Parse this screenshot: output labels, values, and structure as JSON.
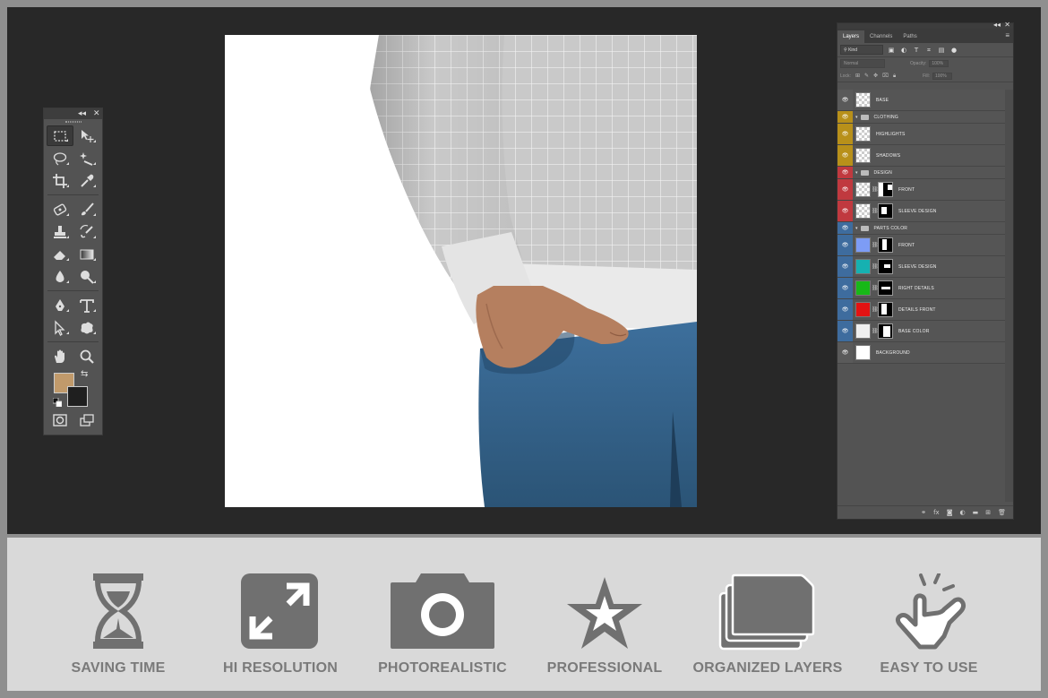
{
  "tools_panel": {
    "collapse_label": "◂◂",
    "close_label": "✕",
    "tools": [
      {
        "name": "rectangular-marquee-tool",
        "active": true
      },
      {
        "name": "move-tool"
      },
      {
        "name": "lasso-tool"
      },
      {
        "name": "magic-wand-tool"
      },
      {
        "name": "crop-tool"
      },
      {
        "name": "eyedropper-tool"
      },
      {
        "name": "spot-healing-brush-tool"
      },
      {
        "name": "brush-tool"
      },
      {
        "name": "clone-stamp-tool"
      },
      {
        "name": "history-brush-tool"
      },
      {
        "name": "eraser-tool"
      },
      {
        "name": "gradient-tool"
      },
      {
        "name": "blur-tool"
      },
      {
        "name": "dodge-tool"
      },
      {
        "name": "pen-tool"
      },
      {
        "name": "type-tool"
      },
      {
        "name": "path-selection-tool"
      },
      {
        "name": "custom-shape-tool"
      },
      {
        "name": "hand-tool"
      },
      {
        "name": "zoom-tool"
      }
    ],
    "foreground_color": "#c19a6b",
    "background_color": "#1f1f1f"
  },
  "layers_panel": {
    "tabs": [
      {
        "label": "Layers",
        "active": true
      },
      {
        "label": "Channels"
      },
      {
        "label": "Paths"
      }
    ],
    "filter_kind": "Kind",
    "blend_mode": "Normal",
    "opacity_label": "Opacity:",
    "opacity_value": "100%",
    "lock_label": "Lock:",
    "fill_label": "Fill:",
    "fill_value": "100%",
    "layers": [
      {
        "name": "BASE",
        "type": "layer",
        "eye_color": "#5a5a5a",
        "thumb": "checker",
        "mask": false
      },
      {
        "name": "CLOTHING",
        "type": "group",
        "eye_color": "#b8901a"
      },
      {
        "name": "HIGHLIGHTS",
        "type": "layer",
        "eye_color": "#b8901a",
        "thumb": "checker",
        "mask": false
      },
      {
        "name": "SHADOWS",
        "type": "layer",
        "eye_color": "#b8901a",
        "thumb": "checker",
        "mask": false
      },
      {
        "name": "DESIGN",
        "type": "group",
        "eye_color": "#c0393f"
      },
      {
        "name": "FRONT",
        "type": "layer",
        "eye_color": "#c0393f",
        "thumb": "checker",
        "mask": true
      },
      {
        "name": "SLEEVE DESIGN",
        "type": "layer",
        "eye_color": "#c0393f",
        "thumb": "checker",
        "mask": true
      },
      {
        "name": "PARTS COLOR",
        "type": "group",
        "eye_color": "#3e6c9e"
      },
      {
        "name": "FRONT",
        "type": "layer",
        "eye_color": "#3e6c9e",
        "thumb": "#7d9cf5",
        "mask": true
      },
      {
        "name": "SLEEVE DESIGN",
        "type": "layer",
        "eye_color": "#3e6c9e",
        "thumb": "#16b1b1",
        "mask": true
      },
      {
        "name": "RIGHT DETAILS",
        "type": "layer",
        "eye_color": "#3e6c9e",
        "thumb": "#18b818",
        "mask": true
      },
      {
        "name": "DETAILS FRONT",
        "type": "layer",
        "eye_color": "#3e6c9e",
        "thumb": "#e31212",
        "mask": true
      },
      {
        "name": "BASE COLOR",
        "type": "layer",
        "eye_color": "#3e6c9e",
        "thumb": "#eeeeee",
        "mask": true
      },
      {
        "name": "BACKGROUND",
        "type": "layer",
        "eye_color": "#5a5a5a",
        "thumb": "#ffffff",
        "mask": false
      }
    ]
  },
  "features": [
    {
      "label": "SAVING TIME",
      "icon": "hourglass-icon"
    },
    {
      "label": "HI RESOLUTION",
      "icon": "expand-icon"
    },
    {
      "label": "PHOTOREALISTIC",
      "icon": "camera-icon"
    },
    {
      "label": "PROFESSIONAL",
      "icon": "star-icon"
    },
    {
      "label": "ORGANIZED LAYERS",
      "icon": "stacked-layers-icon"
    },
    {
      "label": "EASY TO USE",
      "icon": "tap-hand-icon"
    }
  ],
  "colors": {
    "workspace": "#282828",
    "feature_bar": "#d9d9d9",
    "feature_icon": "#707070"
  }
}
